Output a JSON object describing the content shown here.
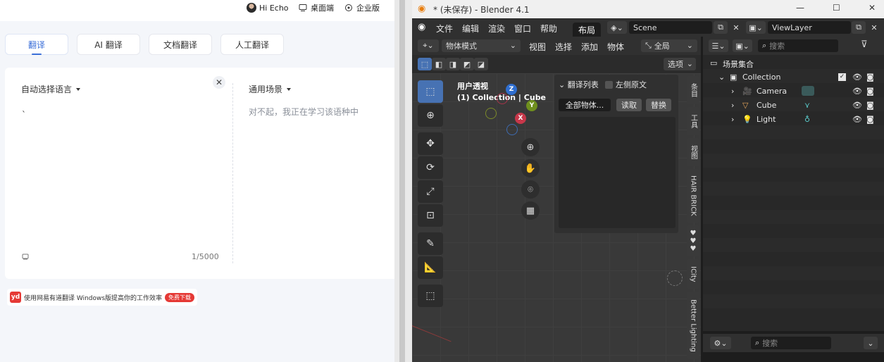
{
  "youdao": {
    "topbar": {
      "user": "Hi Echo",
      "desktop": "桌面端",
      "enterprise": "企业版"
    },
    "tabs": [
      "翻译",
      "AI 翻译",
      "文档翻译",
      "人工翻译"
    ],
    "source_lang": "自动选择语言",
    "source_text": "`",
    "char_counter": "1/5000",
    "target_scene": "通用场景",
    "target_placeholder": "对不起，我正在学习该语种中",
    "promo": {
      "logo": "yd",
      "text": "使用网易有道翻译 Windows版提高你的工作效率",
      "button": "免费下载"
    }
  },
  "blender": {
    "title": "* (未保存) - Blender 4.1",
    "menu": [
      "文件",
      "编辑",
      "渲染",
      "窗口",
      "帮助"
    ],
    "workspace": "布局",
    "scene": "Scene",
    "view_layer": "ViewLayer",
    "viewport_header": {
      "mode": "物体模式",
      "menus": [
        "视图",
        "选择",
        "添加",
        "物体"
      ],
      "transform": "全局",
      "options": "选项"
    },
    "viewport": {
      "view_name": "用户透视",
      "context": "(1) Collection | Cube"
    },
    "gizmo": {
      "z": "Z",
      "y": "Y",
      "x": "X"
    },
    "translate_panel": {
      "title": "翻译列表",
      "checkbox": "左侧原文",
      "dropdown": "全部物体...",
      "read": "读取",
      "replace": "替换"
    },
    "side_tabs": [
      "条目",
      "工具",
      "视图",
      "HAIR BRICK",
      "♥♥♥",
      "ICity",
      "Better Lighting"
    ],
    "outliner": {
      "search_placeholder": "搜索",
      "root": "场景集合",
      "items": [
        "Collection",
        "Camera",
        "Cube",
        "Light"
      ]
    },
    "properties": {
      "search_placeholder": "搜索"
    }
  }
}
